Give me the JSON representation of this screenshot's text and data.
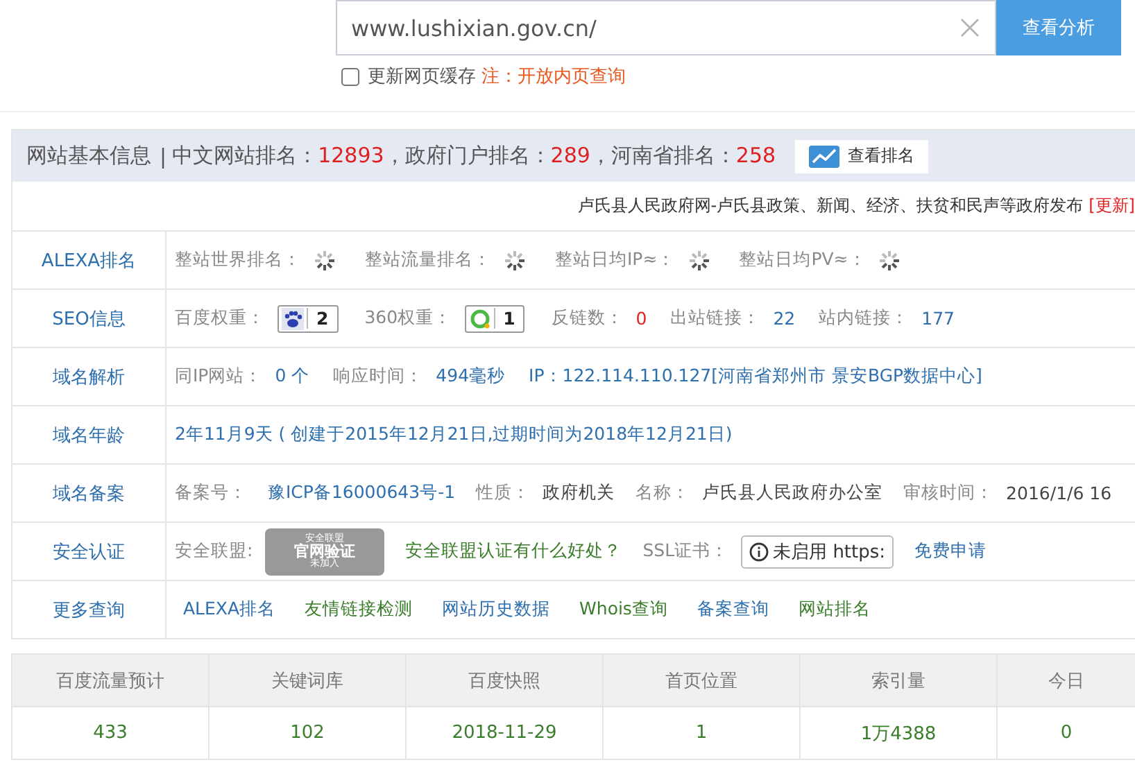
{
  "search": {
    "value": "www.lushixian.gov.cn/",
    "button": "查看分析",
    "refresh": {
      "label": "更新网页缓存",
      "checked": false
    },
    "note": "注：开放内页查询"
  },
  "info": {
    "title": "网站基本信息",
    "separator": "|",
    "ranks": [
      {
        "label": "中文网站排名：",
        "value": "12893"
      },
      {
        "label": "，政府门户排名：",
        "value": "289"
      },
      {
        "label": "，河南省排名：",
        "value": "258"
      }
    ],
    "rank_button": "查看排名",
    "description": "卢氏县人民政府网-卢氏县政策、新闻、经济、扶贫和民声等政府发布",
    "update_link": "[更新]"
  },
  "rows": [
    {
      "label": "ALEXA排名",
      "items": [
        {
          "kind": "label",
          "text": "整站世界排名："
        },
        {
          "kind": "loading"
        },
        {
          "kind": "label",
          "text": "整站流量排名："
        },
        {
          "kind": "loading"
        },
        {
          "kind": "label",
          "text": "整站日均IP≈："
        },
        {
          "kind": "loading"
        },
        {
          "kind": "label",
          "text": "整站日均PV≈："
        },
        {
          "kind": "loading"
        }
      ]
    },
    {
      "label": "SEO信息",
      "items": [
        {
          "kind": "label",
          "text": "百度权重："
        },
        {
          "kind": "paw-badge",
          "text": "2"
        },
        {
          "kind": "label",
          "text": "360权重："
        },
        {
          "kind": "ring-badge",
          "text": "1"
        },
        {
          "kind": "label",
          "text": "反链数："
        },
        {
          "kind": "alert",
          "text": "0"
        },
        {
          "kind": "label",
          "text": "出站链接："
        },
        {
          "kind": "value",
          "text": "22"
        },
        {
          "kind": "label",
          "text": "站内链接："
        },
        {
          "kind": "value",
          "text": "177"
        }
      ]
    },
    {
      "label": "域名解析",
      "items": [
        {
          "kind": "label",
          "text": "同IP网站："
        },
        {
          "kind": "value",
          "text": "0 个"
        },
        {
          "kind": "label",
          "text": "响应时间："
        },
        {
          "kind": "value",
          "text": "494毫秒"
        },
        {
          "kind": "value",
          "text": "IP：122.114.110.127[河南省郑州市 景安BGP数据中心]"
        }
      ]
    },
    {
      "label": "域名年龄",
      "items": [
        {
          "kind": "value",
          "text": "2年11月9天 ( 创建于2015年12月21日,过期时间为2018年12月21日)"
        }
      ]
    },
    {
      "label": "域名备案",
      "items": [
        {
          "kind": "label",
          "text": "备案号："
        },
        {
          "kind": "link",
          "text": "豫ICP备16000643号-1"
        },
        {
          "kind": "label",
          "text": "性质："
        },
        {
          "kind": "plain",
          "text": "政府机关"
        },
        {
          "kind": "label",
          "text": "名称："
        },
        {
          "kind": "plain",
          "text": "卢氏县人民政府办公室"
        },
        {
          "kind": "label",
          "text": "审核时间："
        },
        {
          "kind": "plain",
          "text": "2016/1/6 16"
        }
      ]
    },
    {
      "label": "安全认证",
      "items": [
        {
          "kind": "label",
          "text": "安全联盟:"
        },
        {
          "kind": "seal",
          "top": "安全联盟",
          "main": "官网验证",
          "bottom": "未加入"
        },
        {
          "kind": "good-link",
          "text": "安全联盟认证有什么好处？"
        },
        {
          "kind": "label",
          "text": "SSL证书："
        },
        {
          "kind": "ssl",
          "text": "未启用 https:"
        },
        {
          "kind": "link",
          "text": "免费申请"
        }
      ]
    },
    {
      "label": "更多查询",
      "items": [
        {
          "kind": "link",
          "text": "ALEXA排名"
        },
        {
          "kind": "good-link",
          "text": "友情链接检测"
        },
        {
          "kind": "link",
          "text": "网站历史数据"
        },
        {
          "kind": "good-link",
          "text": "Whois查询"
        },
        {
          "kind": "link",
          "text": "备案查询"
        },
        {
          "kind": "good-link",
          "text": "网站排名"
        }
      ]
    }
  ],
  "stats": {
    "columns": [
      "百度流量预计",
      "关键词库",
      "百度快照",
      "首页位置",
      "索引量",
      "今日"
    ],
    "values": [
      "433",
      "102",
      "2018-11-29",
      "1",
      "1万4388",
      "0"
    ]
  }
}
